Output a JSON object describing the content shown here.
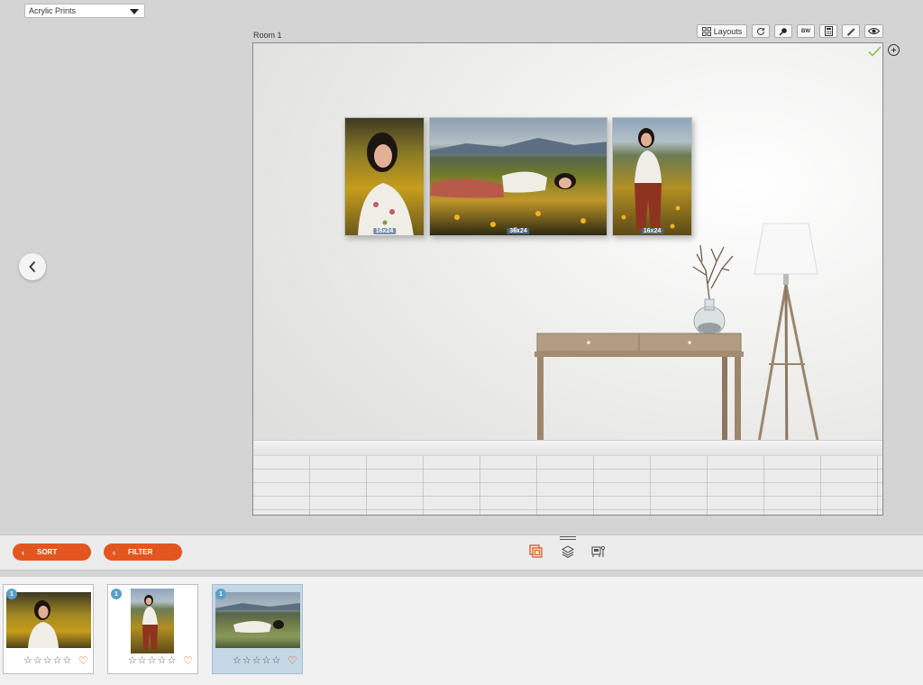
{
  "product_select": {
    "value": "Acrylic Prints"
  },
  "room": {
    "label": "Room 1"
  },
  "toolbar": {
    "layouts_label": "Layouts",
    "bw_label": "BW",
    "icons": [
      "grid-icon",
      "refresh-icon",
      "zoom-icon",
      "bw-icon",
      "calculator-icon",
      "ruler-icon",
      "eye-icon"
    ]
  },
  "wall_prints": [
    {
      "size": "16x24"
    },
    {
      "size": "36x24"
    },
    {
      "size": "16x24"
    }
  ],
  "controls": {
    "sort_label": "SORT",
    "filter_label": "FILTER",
    "icons": [
      "photos-icon",
      "layers-icon",
      "room-settings-icon"
    ]
  },
  "thumbnails": [
    {
      "badge": "1",
      "stars": [
        "☆",
        "☆",
        "☆",
        "☆",
        "☆"
      ],
      "favorite": "♡"
    },
    {
      "badge": "1",
      "stars": [
        "☆",
        "☆",
        "☆",
        "☆",
        "☆"
      ],
      "favorite": "♡"
    },
    {
      "badge": "1",
      "stars": [
        "☆",
        "☆",
        "☆",
        "☆",
        "☆"
      ],
      "favorite": "♡"
    }
  ],
  "colors": {
    "accent": "#e3561f",
    "badge": "#5aa0c8",
    "selected_thumb": "#c5d8e5"
  }
}
